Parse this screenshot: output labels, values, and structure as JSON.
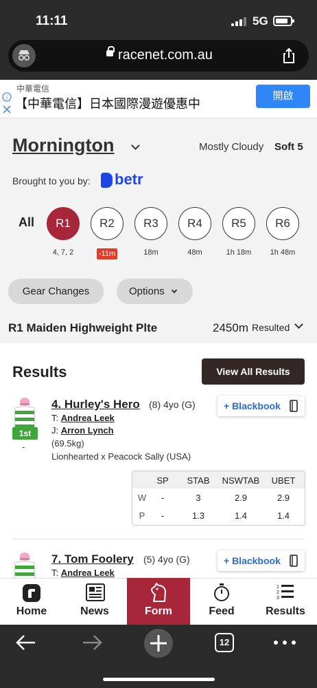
{
  "status": {
    "time": "11:11",
    "network": "5G"
  },
  "browser": {
    "url": "racenet.com.au",
    "tab_count": "12"
  },
  "ad": {
    "brand": "中華電信",
    "text": "【中華電信】日本國際漫遊優惠中",
    "button": "開啟"
  },
  "meeting": {
    "venue": "Mornington",
    "weather": "Mostly Cloudy",
    "track": "Soft 5",
    "brought_by": "Brought to you by:",
    "sponsor": "betr"
  },
  "races": {
    "all_label": "All",
    "items": [
      {
        "label": "R1",
        "sub": "4, 7, 2"
      },
      {
        "label": "R2",
        "sub": "-11m"
      },
      {
        "label": "R3",
        "sub": "18m"
      },
      {
        "label": "R4",
        "sub": "48m"
      },
      {
        "label": "R5",
        "sub": "1h 18m"
      },
      {
        "label": "R6",
        "sub": "1h 48m"
      }
    ]
  },
  "filters": {
    "gear": "Gear Changes",
    "options": "Options"
  },
  "race": {
    "title": "R1 Maiden Highweight Plte",
    "distance": "2450m",
    "status": "Resulted"
  },
  "results": {
    "heading": "Results",
    "view_all": "View All Results",
    "runners": [
      {
        "place": "1st",
        "name": "4. Hurley's Hero",
        "meta": "(8) 4yo (G)",
        "trainer_label": "T:",
        "trainer": "Andrea Leek",
        "jockey_label": "J:",
        "jockey": "Arron Lynch",
        "weight": "(69.5kg)",
        "breeding": "Lionhearted x Peacock Sally (USA)",
        "blackbook": "+ Blackbook",
        "odds": {
          "headers": [
            "",
            "SP",
            "STAB",
            "NSWTAB",
            "UBET"
          ],
          "rows": [
            [
              "W",
              "-",
              "3",
              "2.9",
              "2.9"
            ],
            [
              "P",
              "-",
              "1.3",
              "1.4",
              "1.4"
            ]
          ]
        }
      },
      {
        "name": "7. Tom Foolery",
        "meta": "(5) 4yo (G)",
        "trainer_label": "T:",
        "trainer": "Andrea Leek",
        "blackbook": "+ Blackbook"
      }
    ]
  },
  "tabs": [
    {
      "label": "Home",
      "icon": "racenet-logo-icon"
    },
    {
      "label": "News",
      "icon": "newspaper-icon"
    },
    {
      "label": "Form",
      "icon": "horse-head-icon"
    },
    {
      "label": "Feed",
      "icon": "stopwatch-icon"
    },
    {
      "label": "Results",
      "icon": "list-icon"
    }
  ],
  "colors": {
    "accent": "#a8263a",
    "dark_button": "#332826",
    "link": "#2a6ad9",
    "place_badge": "#3fa63b",
    "sponsor": "#1e46e6"
  }
}
